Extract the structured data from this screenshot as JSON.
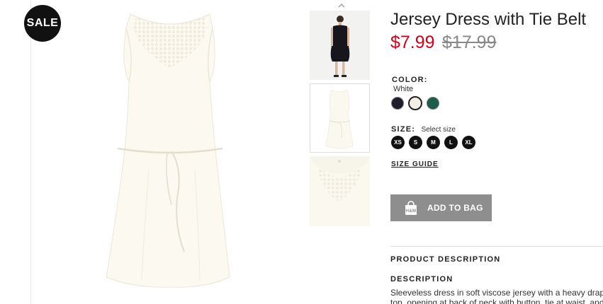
{
  "badge": {
    "sale_label": "SALE"
  },
  "product": {
    "title": "Jersey Dress with Tie Belt",
    "price_sale": "$7.99",
    "price_original": "$17.99"
  },
  "color": {
    "label": "COLOR:",
    "selected": "White",
    "swatches": [
      {
        "name": "navy",
        "hex": "#1e1f2b"
      },
      {
        "name": "white",
        "hex": "#f4efe4"
      },
      {
        "name": "green",
        "hex": "#1c5c4a"
      }
    ]
  },
  "size": {
    "label": "SIZE:",
    "hint": "Select size",
    "options": [
      "XS",
      "S",
      "M",
      "L",
      "XL"
    ],
    "guide_label": "SIZE GUIDE"
  },
  "cart": {
    "add_label": "ADD TO BAG",
    "bag_logo_text": "H&M"
  },
  "description": {
    "section_title": "PRODUCT DESCRIPTION",
    "heading": "DESCRIPTION",
    "line1": "Sleeveless dress in soft viscose jersey with a heavy draped",
    "line2": "top, opening at back of neck with button, tie at waist, and"
  },
  "colors": {
    "sale_price": "#d0021b",
    "badge_bg": "#111111",
    "button_bg": "#8e8e8e"
  },
  "icons": {
    "thumb_scroll_up": "chevron-up-icon",
    "bag": "shopping-bag-icon"
  }
}
